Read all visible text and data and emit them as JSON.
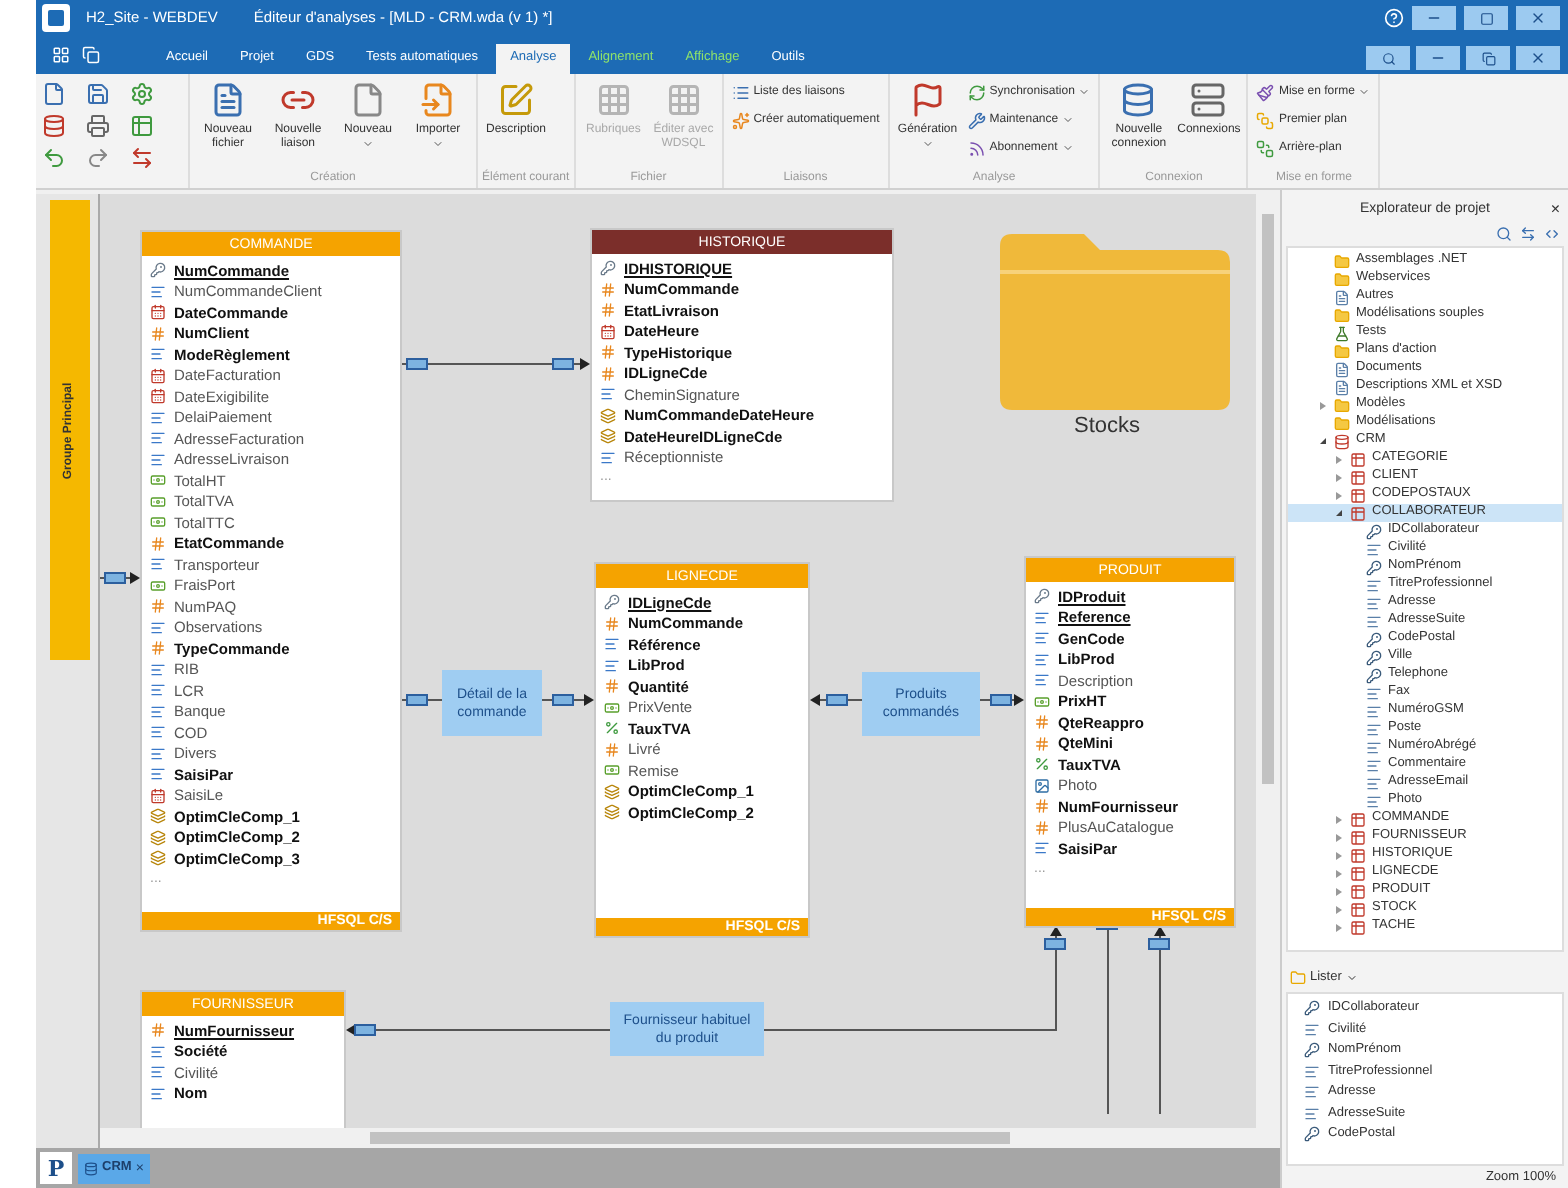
{
  "window": {
    "app": "H2_Site - WEBDEV",
    "title": "Éditeur d'analyses - [MLD - CRM.wda (v 1) *]"
  },
  "tabs": [
    {
      "label": "Accueil",
      "selected": false,
      "contextual": false
    },
    {
      "label": "Projet",
      "selected": false,
      "contextual": false
    },
    {
      "label": "GDS",
      "selected": false,
      "contextual": false
    },
    {
      "label": "Tests automatiques",
      "selected": false,
      "contextual": false
    },
    {
      "label": "Analyse",
      "selected": true,
      "contextual": false
    },
    {
      "label": "Alignement",
      "selected": false,
      "contextual": true
    },
    {
      "label": "Affichage",
      "selected": false,
      "contextual": true
    },
    {
      "label": "Outils",
      "selected": false,
      "contextual": false
    }
  ],
  "ribbon": [
    {
      "label": "Création",
      "buttons": [
        {
          "label": "Nouveau fichier",
          "kind": "large",
          "disabled": false,
          "dropdown": false
        },
        {
          "label": "Nouvelle liaison",
          "kind": "large",
          "disabled": false,
          "dropdown": false
        },
        {
          "label": "Nouveau",
          "kind": "large",
          "disabled": false,
          "dropdown": true
        },
        {
          "label": "Importer",
          "kind": "large",
          "disabled": false,
          "dropdown": true
        }
      ]
    },
    {
      "label": "Élément courant",
      "buttons": [
        {
          "label": "Description",
          "kind": "large",
          "disabled": false,
          "dropdown": false
        }
      ]
    },
    {
      "label": "Fichier",
      "buttons": [
        {
          "label": "Rubriques",
          "kind": "large",
          "disabled": true,
          "dropdown": false
        },
        {
          "label": "Éditer avec WDSQL",
          "kind": "large",
          "disabled": true,
          "dropdown": false
        }
      ]
    },
    {
      "label": "Liaisons",
      "buttons": [
        {
          "label": "Liste des liaisons",
          "kind": "small",
          "disabled": false,
          "dropdown": false
        },
        {
          "label": "Créer automatiquement",
          "kind": "small",
          "disabled": false,
          "dropdown": false
        }
      ]
    },
    {
      "label": "Analyse",
      "buttons": [
        {
          "label": "Génération",
          "kind": "large",
          "disabled": false,
          "dropdown": true
        },
        {
          "label": "Synchronisation",
          "kind": "small",
          "disabled": false,
          "dropdown": true
        },
        {
          "label": "Maintenance",
          "kind": "small",
          "disabled": false,
          "dropdown": true
        },
        {
          "label": "Abonnement",
          "kind": "small",
          "disabled": false,
          "dropdown": true
        }
      ]
    },
    {
      "label": "Connexion",
      "buttons": [
        {
          "label": "Nouvelle connexion",
          "kind": "large",
          "disabled": false,
          "dropdown": false
        },
        {
          "label": "Connexions",
          "kind": "large",
          "disabled": false,
          "dropdown": false
        }
      ]
    },
    {
      "label": "Mise en forme",
      "buttons": [
        {
          "label": "Mise en forme",
          "kind": "small",
          "disabled": false,
          "dropdown": true
        },
        {
          "label": "Premier plan",
          "kind": "small",
          "disabled": false,
          "dropdown": false
        },
        {
          "label": "Arrière-plan",
          "kind": "small",
          "disabled": false,
          "dropdown": false
        }
      ]
    }
  ],
  "group": {
    "label": "Groupe Principal"
  },
  "tables": [
    {
      "name": "COMMANDE",
      "color": "#f5a300",
      "footer": "HFSQL C/S",
      "more": "...",
      "fields": [
        {
          "name": "NumCommande",
          "kind": "key",
          "bold": true,
          "key": true
        },
        {
          "name": "NumCommandeClient",
          "kind": "text",
          "bold": false,
          "key": false
        },
        {
          "name": "DateCommande",
          "kind": "date",
          "bold": true,
          "key": false
        },
        {
          "name": "NumClient",
          "kind": "number",
          "bold": true,
          "key": false
        },
        {
          "name": "ModeRèglement",
          "kind": "text",
          "bold": true,
          "key": false
        },
        {
          "name": "DateFacturation",
          "kind": "date",
          "bold": false,
          "key": false
        },
        {
          "name": "DateExigibilite",
          "kind": "date",
          "bold": false,
          "key": false
        },
        {
          "name": "DelaiPaiement",
          "kind": "text",
          "bold": false,
          "key": false
        },
        {
          "name": "AdresseFacturation",
          "kind": "text",
          "bold": false,
          "key": false
        },
        {
          "name": "AdresseLivraison",
          "kind": "text",
          "bold": false,
          "key": false
        },
        {
          "name": "TotalHT",
          "kind": "currency",
          "bold": false,
          "key": false
        },
        {
          "name": "TotalTVA",
          "kind": "currency",
          "bold": false,
          "key": false
        },
        {
          "name": "TotalTTC",
          "kind": "currency",
          "bold": false,
          "key": false
        },
        {
          "name": "EtatCommande",
          "kind": "number",
          "bold": true,
          "key": false
        },
        {
          "name": "Transporteur",
          "kind": "text",
          "bold": false,
          "key": false
        },
        {
          "name": "FraisPort",
          "kind": "currency",
          "bold": false,
          "key": false
        },
        {
          "name": "NumPAQ",
          "kind": "number",
          "bold": false,
          "key": false
        },
        {
          "name": "Observations",
          "kind": "text",
          "bold": false,
          "key": false
        },
        {
          "name": "TypeCommande",
          "kind": "number",
          "bold": true,
          "key": false
        },
        {
          "name": "RIB",
          "kind": "text",
          "bold": false,
          "key": false
        },
        {
          "name": "LCR",
          "kind": "text",
          "bold": false,
          "key": false
        },
        {
          "name": "Banque",
          "kind": "text",
          "bold": false,
          "key": false
        },
        {
          "name": "COD",
          "kind": "text",
          "bold": false,
          "key": false
        },
        {
          "name": "Divers",
          "kind": "text",
          "bold": false,
          "key": false
        },
        {
          "name": "SaisiPar",
          "kind": "text",
          "bold": true,
          "key": false
        },
        {
          "name": "SaisiLe",
          "kind": "date",
          "bold": false,
          "key": false
        },
        {
          "name": "OptimCleComp_1",
          "kind": "composite",
          "bold": true,
          "key": false
        },
        {
          "name": "OptimCleComp_2",
          "kind": "composite",
          "bold": true,
          "key": false
        },
        {
          "name": "OptimCleComp_3",
          "kind": "composite",
          "bold": true,
          "key": false
        }
      ]
    },
    {
      "name": "HISTORIQUE",
      "color": "#7b2e2a",
      "more": "...",
      "fields": [
        {
          "name": "IDHISTORIQUE",
          "kind": "key",
          "bold": true,
          "key": true
        },
        {
          "name": "NumCommande",
          "kind": "number",
          "bold": true,
          "key": false
        },
        {
          "name": "EtatLivraison",
          "kind": "number",
          "bold": true,
          "key": false
        },
        {
          "name": "DateHeure",
          "kind": "date",
          "bold": true,
          "key": false
        },
        {
          "name": "TypeHistorique",
          "kind": "number",
          "bold": true,
          "key": false
        },
        {
          "name": "IDLigneCde",
          "kind": "number",
          "bold": true,
          "key": false
        },
        {
          "name": "CheminSignature",
          "kind": "text",
          "bold": false,
          "key": false
        },
        {
          "name": "NumCommandeDateHeure",
          "kind": "composite",
          "bold": true,
          "key": false
        },
        {
          "name": "DateHeureIDLigneCde",
          "kind": "composite",
          "bold": true,
          "key": false
        },
        {
          "name": "Réceptionniste",
          "kind": "text",
          "bold": false,
          "key": false
        }
      ]
    },
    {
      "name": "LIGNECDE",
      "color": "#f5a300",
      "footer": "HFSQL C/S",
      "fields": [
        {
          "name": "IDLigneCde",
          "kind": "key",
          "bold": true,
          "key": true
        },
        {
          "name": "NumCommande",
          "kind": "number",
          "bold": true,
          "key": false
        },
        {
          "name": "Référence",
          "kind": "text",
          "bold": true,
          "key": false
        },
        {
          "name": "LibProd",
          "kind": "text",
          "bold": true,
          "key": false
        },
        {
          "name": "Quantité",
          "kind": "number",
          "bold": true,
          "key": false
        },
        {
          "name": "PrixVente",
          "kind": "currency",
          "bold": false,
          "key": false
        },
        {
          "name": "TauxTVA",
          "kind": "decimal",
          "bold": true,
          "key": false
        },
        {
          "name": "Livré",
          "kind": "number",
          "bold": false,
          "key": false
        },
        {
          "name": "Remise",
          "kind": "currency",
          "bold": false,
          "key": false
        },
        {
          "name": "OptimCleComp_1",
          "kind": "composite",
          "bold": true,
          "key": false
        },
        {
          "name": "OptimCleComp_2",
          "kind": "composite",
          "bold": true,
          "key": false
        }
      ]
    },
    {
      "name": "PRODUIT",
      "color": "#f5a300",
      "footer": "HFSQL C/S",
      "more": "...",
      "fields": [
        {
          "name": "IDProduit",
          "kind": "key",
          "bold": true,
          "key": true
        },
        {
          "name": "Reference",
          "kind": "text",
          "bold": true,
          "key": true
        },
        {
          "name": "GenCode",
          "kind": "text",
          "bold": true,
          "key": false
        },
        {
          "name": "LibProd",
          "kind": "text",
          "bold": true,
          "key": false
        },
        {
          "name": "Description",
          "kind": "text",
          "bold": false,
          "key": false
        },
        {
          "name": "PrixHT",
          "kind": "currency",
          "bold": true,
          "key": false
        },
        {
          "name": "QteReappro",
          "kind": "number",
          "bold": true,
          "key": false
        },
        {
          "name": "QteMini",
          "kind": "number",
          "bold": true,
          "key": false
        },
        {
          "name": "TauxTVA",
          "kind": "decimal",
          "bold": true,
          "key": false
        },
        {
          "name": "Photo",
          "kind": "image",
          "bold": false,
          "key": false
        },
        {
          "name": "NumFournisseur",
          "kind": "number",
          "bold": true,
          "key": false
        },
        {
          "name": "PlusAuCatalogue",
          "kind": "number",
          "bold": false,
          "key": false
        },
        {
          "name": "SaisiPar",
          "kind": "text",
          "bold": true,
          "key": false
        }
      ]
    },
    {
      "name": "FOURNISSEUR",
      "color": "#f5a300",
      "fields": [
        {
          "name": "NumFournisseur",
          "kind": "number",
          "bold": true,
          "key": true
        },
        {
          "name": "Société",
          "kind": "text",
          "bold": true,
          "key": false
        },
        {
          "name": "Civilité",
          "kind": "text",
          "bold": false,
          "key": false
        },
        {
          "name": "Nom",
          "kind": "text",
          "bold": true,
          "key": false
        }
      ]
    }
  ],
  "folder": {
    "label": "Stocks"
  },
  "relations": [
    {
      "label": "Détail de la commande"
    },
    {
      "label": "Produits commandés"
    },
    {
      "label": "Fournisseur habituel du produit"
    }
  ],
  "document_tabs": [
    {
      "label": "CRM",
      "selected": true,
      "close": "×"
    }
  ],
  "project_button": "P",
  "explorer": {
    "title": "Explorateur de projet",
    "close": "×",
    "tree": [
      {
        "label": "Assemblages .NET",
        "kind": "folder"
      },
      {
        "label": "Webservices",
        "kind": "folder"
      },
      {
        "label": "Autres",
        "kind": "doc"
      },
      {
        "label": "Modélisations souples",
        "kind": "folder"
      },
      {
        "label": "Tests",
        "kind": "test"
      },
      {
        "label": "Plans d'action",
        "kind": "folder"
      },
      {
        "label": "Documents",
        "kind": "doc"
      },
      {
        "label": "Descriptions XML et XSD",
        "kind": "doc"
      },
      {
        "label": "Modèles",
        "kind": "folder",
        "expanded": false
      },
      {
        "label": "Modélisations",
        "kind": "folder"
      },
      {
        "label": "CRM",
        "kind": "analysis",
        "expanded": true,
        "children": [
          {
            "label": "CATEGORIE",
            "kind": "table",
            "expanded": false,
            "selected": false
          },
          {
            "label": "CLIENT",
            "kind": "table",
            "expanded": false,
            "selected": false
          },
          {
            "label": "CODEPOSTAUX",
            "kind": "table",
            "expanded": false,
            "selected": false
          },
          {
            "label": "COLLABORATEUR",
            "kind": "table",
            "expanded": true,
            "selected": true,
            "children": [
              {
                "label": "IDCollaborateur",
                "kind": "key"
              },
              {
                "label": "Civilité",
                "kind": "field"
              },
              {
                "label": "NomPrénom",
                "kind": "key"
              },
              {
                "label": "TitreProfessionnel",
                "kind": "field"
              },
              {
                "label": "Adresse",
                "kind": "field"
              },
              {
                "label": "AdresseSuite",
                "kind": "field"
              },
              {
                "label": "CodePostal",
                "kind": "key"
              },
              {
                "label": "Ville",
                "kind": "key"
              },
              {
                "label": "Telephone",
                "kind": "key"
              },
              {
                "label": "Fax",
                "kind": "field"
              },
              {
                "label": "NuméroGSM",
                "kind": "field"
              },
              {
                "label": "Poste",
                "kind": "field"
              },
              {
                "label": "NuméroAbrégé",
                "kind": "field"
              },
              {
                "label": "Commentaire",
                "kind": "field"
              },
              {
                "label": "AdresseEmail",
                "kind": "field"
              },
              {
                "label": "Photo",
                "kind": "field"
              }
            ]
          },
          {
            "label": "COMMANDE",
            "kind": "table",
            "expanded": false,
            "selected": false
          },
          {
            "label": "FOURNISSEUR",
            "kind": "table",
            "expanded": false,
            "selected": false
          },
          {
            "label": "HISTORIQUE",
            "kind": "table",
            "expanded": false,
            "selected": false
          },
          {
            "label": "LIGNECDE",
            "kind": "table",
            "expanded": false,
            "selected": false
          },
          {
            "label": "PRODUIT",
            "kind": "table",
            "expanded": false,
            "selected": false
          },
          {
            "label": "STOCK",
            "kind": "table",
            "expanded": false,
            "selected": false
          },
          {
            "label": "TACHE",
            "kind": "table",
            "expanded": false,
            "selected": false
          }
        ]
      }
    ]
  },
  "lister": {
    "label": "Lister",
    "items": [
      {
        "label": "IDCollaborateur",
        "kind": "key"
      },
      {
        "label": "Civilité",
        "kind": "field"
      },
      {
        "label": "NomPrénom",
        "kind": "key"
      },
      {
        "label": "TitreProfessionnel",
        "kind": "field"
      },
      {
        "label": "Adresse",
        "kind": "field"
      },
      {
        "label": "AdresseSuite",
        "kind": "field"
      },
      {
        "label": "CodePostal",
        "kind": "key"
      }
    ]
  },
  "status_bar": {
    "zoom": "Zoom 100%"
  }
}
